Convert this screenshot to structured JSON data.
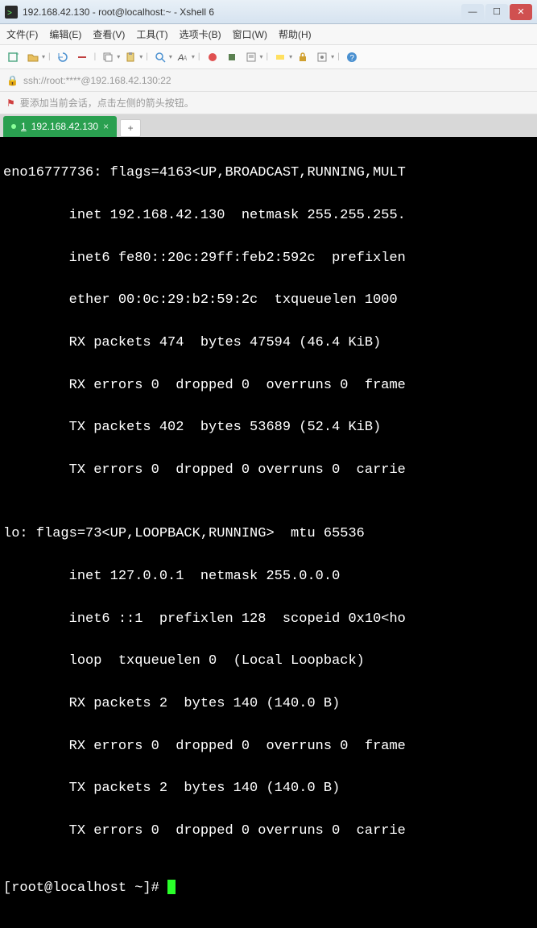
{
  "window": {
    "title": "192.168.42.130 - root@localhost:~ - Xshell 6"
  },
  "menu": {
    "file": "文件(F)",
    "edit": "编辑(E)",
    "view": "查看(V)",
    "tools": "工具(T)",
    "tabs": "选项卡(B)",
    "window": "窗口(W)",
    "help": "帮助(H)"
  },
  "address": {
    "text": "ssh://root:****@192.168.42.130:22"
  },
  "hint": {
    "text": "要添加当前会话，点击左侧的箭头按钮。"
  },
  "tab": {
    "prefix": "1",
    "label": "192.168.42.130"
  },
  "new_tab": {
    "label": "+"
  },
  "terminal": {
    "lines": [
      "eno16777736: flags=4163<UP,BROADCAST,RUNNING,MULT",
      "        inet 192.168.42.130  netmask 255.255.255.",
      "        inet6 fe80::20c:29ff:feb2:592c  prefixlen",
      "        ether 00:0c:29:b2:59:2c  txqueuelen 1000 ",
      "        RX packets 474  bytes 47594 (46.4 KiB)",
      "        RX errors 0  dropped 0  overruns 0  frame",
      "        TX packets 402  bytes 53689 (52.4 KiB)",
      "        TX errors 0  dropped 0 overruns 0  carrie",
      "",
      "lo: flags=73<UP,LOOPBACK,RUNNING>  mtu 65536",
      "        inet 127.0.0.1  netmask 255.0.0.0",
      "        inet6 ::1  prefixlen 128  scopeid 0x10<ho",
      "        loop  txqueuelen 0  (Local Loopback)",
      "        RX packets 2  bytes 140 (140.0 B)",
      "        RX errors 0  dropped 0  overruns 0  frame",
      "        TX packets 2  bytes 140 (140.0 B)",
      "        TX errors 0  dropped 0 overruns 0  carrie"
    ],
    "prompt": "[root@localhost ~]# "
  },
  "colors": {
    "tab_active_bg": "#2aa050",
    "cursor": "#2aff2a",
    "close_btn": "#d05050"
  }
}
